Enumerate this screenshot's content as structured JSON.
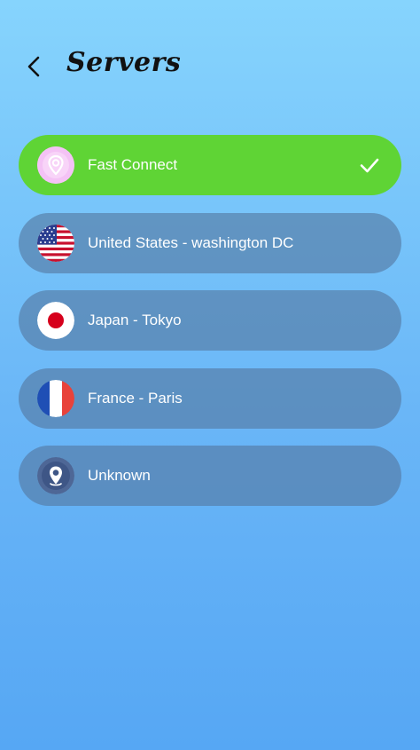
{
  "header": {
    "title": "Servers"
  },
  "servers": [
    {
      "label": "Fast Connect",
      "icon": "location-pin-icon",
      "selected": true
    },
    {
      "label": "United States - washington DC",
      "icon": "us-flag-icon",
      "selected": false
    },
    {
      "label": "Japan - Tokyo",
      "icon": "japan-flag-icon",
      "selected": false
    },
    {
      "label": "France - Paris",
      "icon": "france-flag-icon",
      "selected": false
    },
    {
      "label": "Unknown",
      "icon": "location-pin-icon",
      "selected": false
    }
  ],
  "colors": {
    "selected_bg": "#5fd435",
    "item_bg": "#5478a0",
    "background_top": "#86d4fd",
    "background_bottom": "#56a7f4"
  }
}
